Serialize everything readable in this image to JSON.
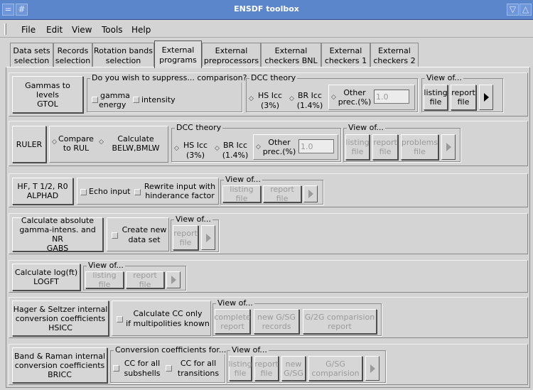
{
  "window": {
    "title": "ENSDF toolbox"
  },
  "menu": [
    "File",
    "Edit",
    "View",
    "Tools",
    "Help"
  ],
  "tabs": [
    {
      "l1": "Data sets",
      "l2": "selection"
    },
    {
      "l1": "Records",
      "l2": "selection"
    },
    {
      "l1": "Rotation bands",
      "l2": "selection"
    },
    {
      "l1": "External",
      "l2": "programs"
    },
    {
      "l1": "External",
      "l2": "preprocessors"
    },
    {
      "l1": "External",
      "l2": "checkers BNL"
    },
    {
      "l1": "External",
      "l2": "checkers 1"
    },
    {
      "l1": "External",
      "l2": "checkers 2"
    }
  ],
  "gtol": {
    "button": {
      "l1": "Gammas to levels",
      "l2": "GTOL"
    },
    "suppress_title": "Do you wish to suppress... comparison?",
    "gamma": {
      "l1": "gamma",
      "l2": "energy"
    },
    "intensity": "intensity",
    "dcc_title": "DCC theory",
    "hs": {
      "l1": "HS Icc",
      "l2": "(3%)"
    },
    "br": {
      "l1": "BR Icc",
      "l2": "(1.4%)"
    },
    "other": {
      "l1": "Other",
      "l2": "prec.(%)"
    },
    "other_value": "1.0",
    "view_title": "View of...",
    "listing": {
      "l1": "listing",
      "l2": "file"
    },
    "report": {
      "l1": "report",
      "l2": "file"
    }
  },
  "ruler": {
    "button": "RULER",
    "compare": {
      "l1": "Compare",
      "l2": "to RUL"
    },
    "calculate": {
      "l1": "Calculate",
      "l2": "BELW,BMLW"
    },
    "dcc_title": "DCC theory",
    "hs": {
      "l1": "HS Icc",
      "l2": "(3%)"
    },
    "br": {
      "l1": "BR Icc",
      "l2": "(1.4%)"
    },
    "other": {
      "l1": "Other",
      "l2": "prec.(%)"
    },
    "other_value": "1.0",
    "view_title": "View of...",
    "listing": {
      "l1": "listing",
      "l2": "file"
    },
    "report": {
      "l1": "report",
      "l2": "file"
    },
    "problems": {
      "l1": "problems",
      "l2": "file"
    }
  },
  "alphad": {
    "button": {
      "l1": "HF, T 1/2, R0",
      "l2": "ALPHAD"
    },
    "echo": "Echo input",
    "rewrite": {
      "l1": "Rewrite input with",
      "l2": "hinderance factor"
    },
    "view_title": "View of...",
    "listing": "listing file",
    "report": "report file"
  },
  "gabs": {
    "button": {
      "l1": "Calculate absolute",
      "l2": "gamma-intens. and NR",
      "l3": "GABS"
    },
    "create": {
      "l1": "Create new",
      "l2": "data set"
    },
    "view_title": "View of...",
    "report": {
      "l1": "report",
      "l2": "file"
    }
  },
  "logft": {
    "button": {
      "l1": "Calculate log(ft)",
      "l2": "LOGFT"
    },
    "view_title": "View of...",
    "listing": "listing file",
    "report": "report file"
  },
  "hsicc": {
    "button": {
      "l1": "Hager & Seltzer internal",
      "l2": "conversion coefficients",
      "l3": "HSICC"
    },
    "calc": {
      "l1": "Calculate CC only",
      "l2": "if multipolities known"
    },
    "view_title": "View of...",
    "complete": {
      "l1": "complete",
      "l2": "report"
    },
    "newgsg": {
      "l1": "new G/SG",
      "l2": "records"
    },
    "g2g": {
      "l1": "G/2G comparision",
      "l2": "report"
    }
  },
  "bricc": {
    "button": {
      "l1": "Band & Raman internal",
      "l2": "conversion coefficients",
      "l3": "BRICC"
    },
    "cc_title": "Conversion coefficients for...",
    "subshells": {
      "l1": "CC for all",
      "l2": "subshells"
    },
    "transitions": {
      "l1": "CC for all",
      "l2": "transitions"
    },
    "view_title": "View of...",
    "listing": {
      "l1": "listing",
      "l2": "file"
    },
    "report": {
      "l1": "report",
      "l2": "file"
    },
    "newgsg": {
      "l1": "new",
      "l2": "G/SG"
    },
    "gsg": {
      "l1": "G/SG",
      "l2": "comparision"
    }
  }
}
